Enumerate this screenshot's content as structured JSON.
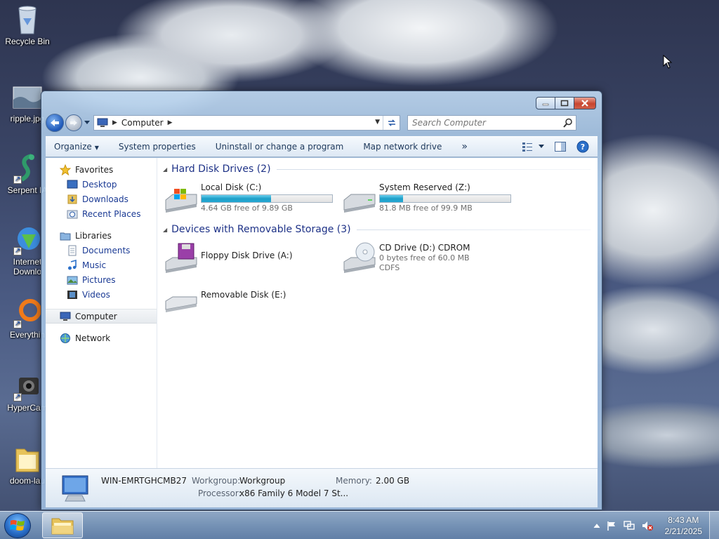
{
  "desktop": {
    "icons": [
      {
        "label": "Recycle Bin",
        "icon": "recycle-bin-icon"
      },
      {
        "label": "ripple.jpg",
        "icon": "image-file-icon"
      },
      {
        "label": "Serpent IA",
        "icon": "serpent-icon"
      },
      {
        "label": "Internet Downlo",
        "icon": "internet-download-manager-icon"
      },
      {
        "label": "Everythin",
        "icon": "everything-search-icon"
      },
      {
        "label": "HyperCam",
        "icon": "hypercam-icon"
      },
      {
        "label": "doom-lau",
        "icon": "folder-icon"
      }
    ]
  },
  "explorer": {
    "address": {
      "segment": "Computer"
    },
    "search": {
      "placeholder": "Search Computer"
    },
    "toolbar": {
      "organize": "Organize",
      "system_properties": "System properties",
      "uninstall": "Uninstall or change a program",
      "map_drive": "Map network drive",
      "more": "»"
    },
    "nav": {
      "favorites": {
        "label": "Favorites",
        "items": [
          "Desktop",
          "Downloads",
          "Recent Places"
        ]
      },
      "libraries": {
        "label": "Libraries",
        "items": [
          "Documents",
          "Music",
          "Pictures",
          "Videos"
        ]
      },
      "computer": "Computer",
      "network": "Network"
    },
    "groups": {
      "hdd": {
        "title": "Hard Disk Drives (2)",
        "drives": [
          {
            "name": "Local Disk (C:)",
            "free": "4.64 GB free of 9.89 GB",
            "used_fraction": 0.53
          },
          {
            "name": "System Reserved (Z:)",
            "free": "81.8 MB free of 99.9 MB",
            "used_fraction": 0.18
          }
        ]
      },
      "removable": {
        "title": "Devices with Removable Storage (3)",
        "drives": [
          {
            "name": "Floppy Disk Drive (A:)"
          },
          {
            "name": "CD Drive (D:) CDROM",
            "free": "0 bytes free of 60.0 MB",
            "fs": "CDFS"
          },
          {
            "name": "Removable Disk (E:)"
          }
        ]
      }
    },
    "details": {
      "computer_name": "WIN-EMRTGHCMB27",
      "workgroup_label": "Workgroup:",
      "workgroup_value": "Workgroup",
      "memory_label": "Memory:",
      "memory_value": "2.00 GB",
      "processor_label": "Processor:",
      "processor_value": "x86 Family 6 Model 7 St..."
    }
  },
  "taskbar": {
    "time": "8:43 AM",
    "date": "2/21/2025"
  }
}
